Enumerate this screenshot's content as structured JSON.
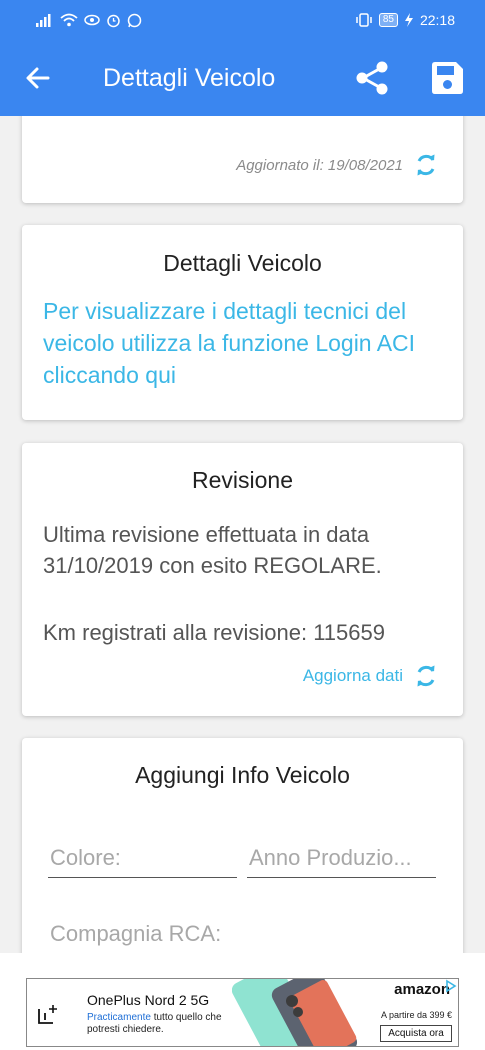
{
  "status_bar": {
    "time": "22:18",
    "battery": "85"
  },
  "app_bar": {
    "title": "Dettagli Veicolo",
    "icons": [
      "arrow-back-icon",
      "share-icon",
      "save-icon"
    ]
  },
  "status_card": {
    "updated_text": "Aggiornato il: 19/08/2021"
  },
  "details_card": {
    "title": "Dettagli Veicolo",
    "login_link": "Per visualizzare i dettagli tecnici del veicolo utilizza la funzione Login ACI cliccando qui"
  },
  "revision_card": {
    "title": "Revisione",
    "text": "Ultima revisione effettuata in data 31/10/2019 con esito REGOLARE.",
    "km_text": "Km registrati alla revisione: 115659",
    "refresh_label": "Aggiorna dati"
  },
  "info_card": {
    "title": "Aggiungi Info Veicolo",
    "color_placeholder": "Colore:",
    "year_placeholder": "Anno Produzio...",
    "rca_placeholder": "Compagnia RCA:"
  },
  "ad": {
    "title": "OnePlus Nord 2 5G",
    "subtitle_highlight": "Practicamente",
    "subtitle_rest": " tutto quello che potresti chiedere.",
    "brand": "amazon",
    "price": "A partire da 399 €",
    "cta": "Acquista ora"
  },
  "colors": {
    "primary": "#3a86f0",
    "link": "#3bb7e6",
    "success": "#2db14b",
    "background": "#f1f1f1"
  }
}
